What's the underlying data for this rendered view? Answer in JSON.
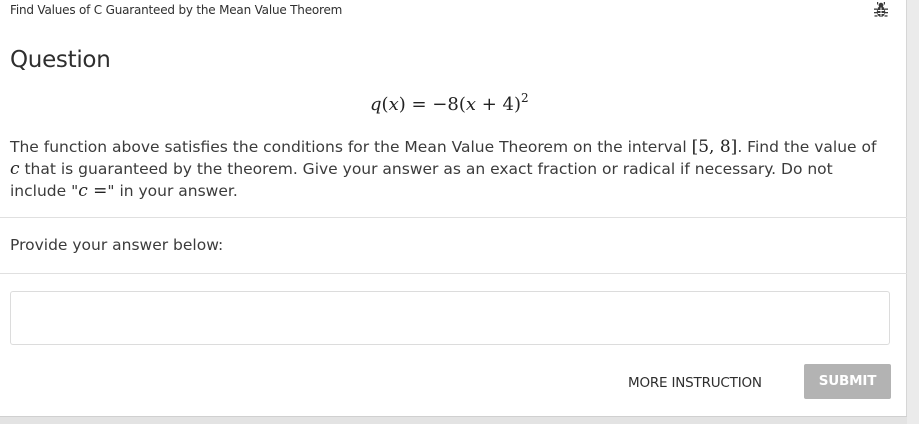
{
  "header": {
    "title": "Find Values of C Guaranteed by the Mean Value Theorem",
    "bug_icon": "bug-icon"
  },
  "question": {
    "heading": "Question",
    "equation": {
      "lhs_func": "q",
      "lhs_var": "x",
      "rhs_coef": "−8(",
      "rhs_var": "x",
      "rhs_tail": " + 4)",
      "exponent": "2"
    },
    "prompt": {
      "part1": "The function above satisfies the conditions for the Mean Value Theorem on the interval ",
      "interval": "[5, 8]",
      "part2": ". Find the value of ",
      "var_c": "c",
      "part3": " that is guaranteed by the theorem. Give your answer as an exact fraction or radical if necessary. Do not include \"",
      "c_equals": "c =",
      "part4": "\" in your answer."
    }
  },
  "answer": {
    "label": "Provide your answer below:",
    "value": "",
    "placeholder": ""
  },
  "actions": {
    "more_instruction_label": "MORE INSTRUCTION",
    "submit_label": "SUBMIT"
  }
}
